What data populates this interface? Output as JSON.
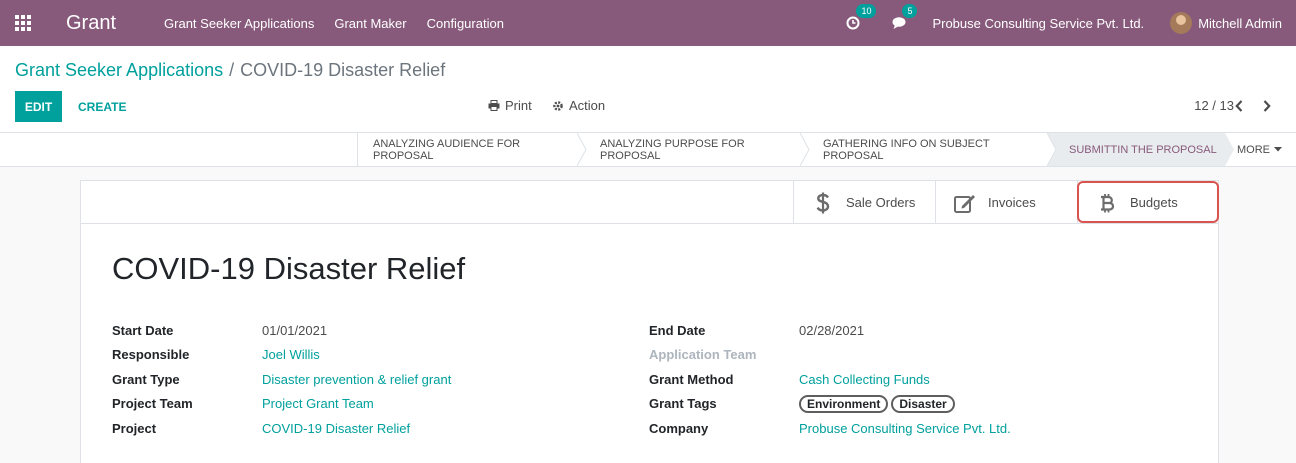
{
  "navbar": {
    "brand": "Grant",
    "menu": [
      "Grant Seeker Applications",
      "Grant Maker",
      "Configuration"
    ],
    "activity_count": "10",
    "messages_count": "5",
    "company": "Probuse Consulting Service Pvt. Ltd.",
    "user": "Mitchell Admin",
    "accent_color": "#875a7b"
  },
  "breadcrumb": {
    "parent": "Grant Seeker Applications",
    "separator": "/",
    "current": "COVID-19 Disaster Relief"
  },
  "buttons": {
    "edit": "EDIT",
    "create": "CREATE",
    "print": "Print",
    "action": "Action"
  },
  "pager": {
    "value": "12 / 13"
  },
  "stages": [
    "ANALYZING AUDIENCE FOR PROPOSAL",
    "ANALYZING PURPOSE FOR PROPOSAL",
    "GATHERING INFO ON SUBJECT PROPOSAL",
    "SUBMITTIN THE PROPOSAL"
  ],
  "active_stage": "SUBMITTIN THE PROPOSAL",
  "more": "MORE",
  "smart_buttons": {
    "sale_orders": "Sale Orders",
    "invoices": "Invoices",
    "budgets": "Budgets"
  },
  "record": {
    "title": "COVID-19 Disaster Relief",
    "left": {
      "start_date_label": "Start Date",
      "start_date": "01/01/2021",
      "responsible_label": "Responsible",
      "responsible": "Joel Willis",
      "grant_type_label": "Grant Type",
      "grant_type": "Disaster prevention & relief grant",
      "project_team_label": "Project Team",
      "project_team": "Project Grant Team",
      "project_label": "Project",
      "project": "COVID-19 Disaster Relief"
    },
    "right": {
      "end_date_label": "End Date",
      "end_date": "02/28/2021",
      "application_team_label": "Application Team",
      "grant_method_label": "Grant Method",
      "grant_method": "Cash Collecting Funds",
      "grant_tags_label": "Grant Tags",
      "grant_tags": [
        "Environment",
        "Disaster"
      ],
      "company_label": "Company",
      "company": "Probuse Consulting Service Pvt. Ltd."
    }
  }
}
